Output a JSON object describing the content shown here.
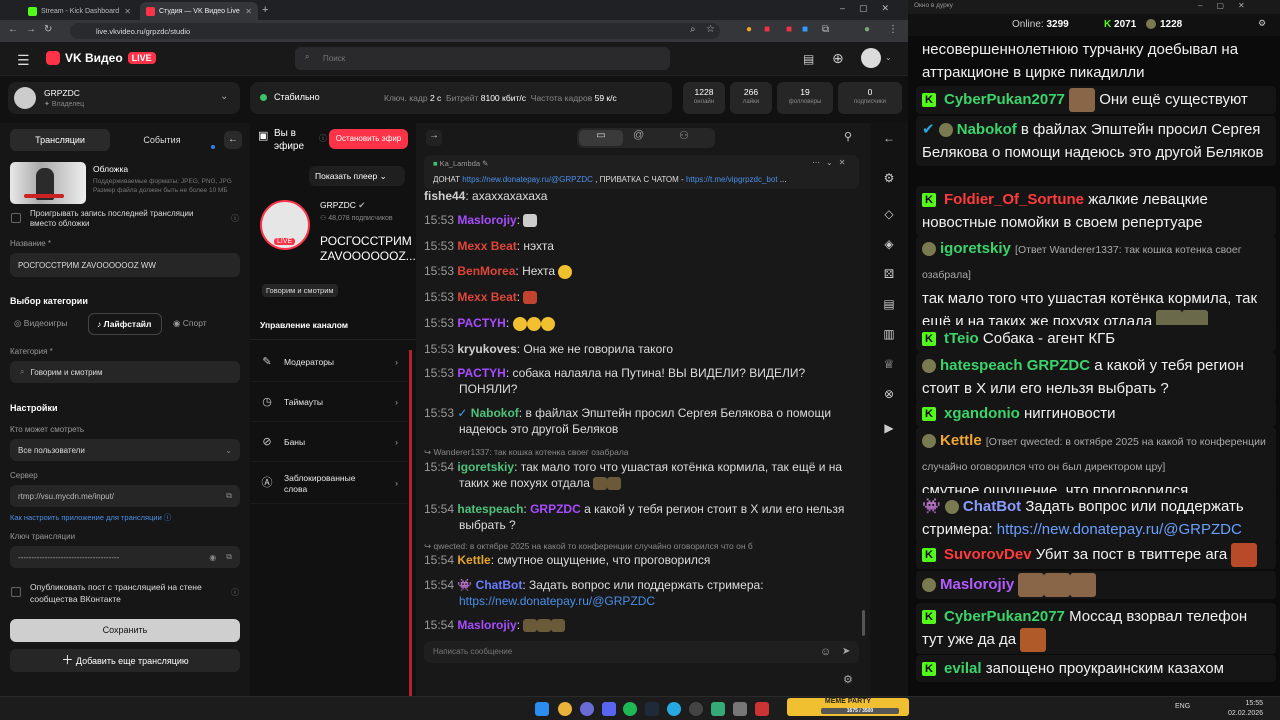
{
  "browser": {
    "tabs": [
      {
        "label": "Stream - Kick Dashboard"
      },
      {
        "label": "Студия — VK Видео Live"
      }
    ],
    "url": "live.vkvideo.ru/grpzdc/studio",
    "new_tab": "+"
  },
  "header": {
    "logo": "VK Видео",
    "live_badge": "LIVE",
    "search_placeholder": "Поиск"
  },
  "channel": {
    "name": "GRPZDC",
    "role": "Владелец"
  },
  "status": {
    "label": "Стабильно",
    "keyframe_label": "Ключ. кадр",
    "keyframe_value": "2 с",
    "bitrate_label": "Битрейт",
    "bitrate_value": "8100 кбит/с",
    "fps_label": "Частота кадров",
    "fps_value": "59 к/с"
  },
  "stats": [
    {
      "value": "1228",
      "label": "онлайн"
    },
    {
      "value": "266",
      "label": "лайки"
    },
    {
      "value": "19",
      "label": "фолловеры"
    },
    {
      "value": "0",
      "label": "подписчики"
    }
  ],
  "left": {
    "tabs": [
      "Трансляции",
      "События"
    ],
    "cover_title": "Обложка",
    "cover_hint": "Поддерживаемые форматы: JPEG, PNG, JPG Размер файла должен быть не более 10 МБ",
    "replay_label": "Проигрывать запись последней трансляции вместо обложки",
    "name_label": "Название *",
    "name_value": "РОСГОССТРИМ ZAVOOOOOOZ WW",
    "category_choice_title": "Выбор категории",
    "cat_games": "Видеоигры",
    "cat_lifestyle": "Лайфстайл",
    "cat_sport": "Спорт",
    "category_label": "Категория *",
    "category_value": "Говорим и смотрим",
    "settings_title": "Настройки",
    "who_label": "Кто может смотреть",
    "who_value": "Все пользователи",
    "server_label": "Сервер",
    "server_value": "rtmp://vsu.mycdn.me/input/",
    "howto_link": "Как настроить приложение для трансляции",
    "key_label": "Ключ трансляции",
    "key_value": "--------------------------------------",
    "publish_label": "Опубликовать пост с трансляцией на стене сообщества ВКонтакте",
    "save_button": "Сохранить",
    "add_button": "Добавить еще трансляцию"
  },
  "middle": {
    "on_air": "Вы в эфире",
    "stop_button": "Остановить эфир",
    "show_player": "Показать плеер",
    "channel": "GRPZDC",
    "subscribers": "48,078 подписчиков",
    "stream_title": "РОСГОССТРИМ ZAVOOOOOOZ...",
    "live_badge": "LIVE",
    "category_chip": "Говорим и смотрим",
    "manage_title": "Управление каналом",
    "menu": [
      "Модераторы",
      "Таймауты",
      "Баны",
      "Заблокированные слова"
    ]
  },
  "chat": {
    "pinned_user": "Ka_Lambda",
    "pinned_text_prefix": "ДОНАТ",
    "pinned_link": "https://new.donatepay.ru/@GRPZDC",
    "pinned_text_mid": ", ПРИВАТКА С ЧАТОМ -",
    "pinned_link2": "https://t.me/vipgrpzdc_bot",
    "pinned_ellipsis": "...",
    "input_placeholder": "Написать сообщение",
    "messages": [
      {
        "time": "",
        "user": "fishe44",
        "color": "#cfcfcf",
        "text": "ахаххахахаха"
      },
      {
        "time": "15:53",
        "user": "Maslorojiy",
        "color": "#a84cff",
        "text": ""
      },
      {
        "time": "15:53",
        "user": "Mexx Beat",
        "color": "#e0453a",
        "text": "нэхта"
      },
      {
        "time": "15:53",
        "user": "BenMorea",
        "color": "#e0453a",
        "text": "Нехта"
      },
      {
        "time": "15:53",
        "user": "Mexx Beat",
        "color": "#e0453a",
        "text": ""
      },
      {
        "time": "15:53",
        "user": "PACTYH",
        "color": "#a84cff",
        "text": ""
      },
      {
        "time": "15:53",
        "user": "kryukoves",
        "color": "#cfcfcf",
        "text": "Она же не говорила такого"
      },
      {
        "time": "15:53",
        "user": "PACTYH",
        "color": "#a84cff",
        "text": "собака налаяла на Путина! ВЫ ВИДЕЛИ? ВИДЕЛИ? ПОНЯЛИ?"
      },
      {
        "time": "15:53",
        "user": "Nabokof",
        "color": "#4ec27a",
        "text": "в файлах Эпштейн просил Сергея Белякова о помощи надеюсь это другой Беляков"
      },
      {
        "time": "15:54",
        "user": "igoretskiy",
        "color": "#4ec27a",
        "text": "так мало того что ушастая котёнка кормила, так ещё и на таких же похуях отдала",
        "reply": "Wanderer1337: так кошка котенка своег озабрала"
      },
      {
        "time": "15:54",
        "user": "hatespeach",
        "color": "#4ec27a",
        "text": "а какой у тебя регион стоит в Х или его нельзя выбрать ?",
        "mention": "GRPZDC"
      },
      {
        "time": "15:54",
        "user": "Kettle",
        "color": "#e7a62c",
        "text": "смутное ощущение, что проговорился",
        "reply": "qwected: в октябре 2025 на какой то конференции случайно оговорился что он б"
      },
      {
        "time": "15:54",
        "user": "ChatBot",
        "color": "#6c7cff",
        "text": "Задать вопрос или поддержать стримера:",
        "link": "https://new.donatepay.ru/@GRPZDC"
      },
      {
        "time": "15:54",
        "user": "Maslorojiy",
        "color": "#a84cff",
        "text": ""
      }
    ]
  },
  "kick": {
    "window_title": "Окно в дурку",
    "online_label": "Online:",
    "online_value": "3299",
    "kick_count": "2071",
    "vk_count": "1228",
    "messages": [
      {
        "user": "",
        "text": "несовершеннолетнюю турчанку доебывал на аттракционе в цирке пикадилли"
      },
      {
        "user": "CyberPukan2077",
        "color": "#3bd46a",
        "text": "Они ещё существуют"
      },
      {
        "user": "Nabokof",
        "color": "#3bd46a",
        "text": "в файлах Эпштейн просил Сергея Белякова о помощи надеюсь это другой Беляков"
      },
      {
        "user": "Foldier_Of_Sortune",
        "color": "#ff3b3b",
        "text": "жалкие левацкие новостные помойки в своем репертуаре"
      },
      {
        "user": "igoretskiy",
        "color": "#3bd46a",
        "reply": "[Ответ Wanderer1337: так кошка котенка своег озабрала]",
        "text": "так мало того что ушастая котёнка кормила, так ещё и на таких же похуях отдала"
      },
      {
        "user": "tTeio",
        "color": "#3bd46a",
        "text": "Собака - агент КГБ"
      },
      {
        "user": "hatespeach",
        "color": "#3bd46a",
        "mention": "GRPZDC",
        "text": "а какой у тебя регион стоит в Х или его нельзя выбрать ?"
      },
      {
        "user": "xgandonio",
        "color": "#3bd46a",
        "text": "ниггиновости"
      },
      {
        "user": "Kettle",
        "color": "#f0a830",
        "reply": "[Ответ qwected: в октябре 2025 на какой то конференции случайно оговорился что он был директором цру]",
        "text": "смутное ощущение, что проговорился"
      },
      {
        "user": "ChatBot",
        "color": "#8a9bff",
        "text": "Задать вопрос или поддержать стримера:",
        "link": "https://new.donatepay.ru/@GRPZDC"
      },
      {
        "user": "SuvorovDev",
        "color": "#ff3b3b",
        "text": "Убит за пост в твиттере ага"
      },
      {
        "user": "Maslorojiy",
        "color": "#b45cff",
        "text": ""
      },
      {
        "user": "CyberPukan2077",
        "color": "#3bd46a",
        "text": "Моссад взорвал телефон тут уже да да"
      },
      {
        "user": "evilal",
        "color": "#3bd46a",
        "text": "запощено проукраинским казахом"
      }
    ]
  },
  "taskbar": {
    "lang": "ENG",
    "time": "15:55",
    "date": "02.02.2026",
    "widget_title": "MEME PARTY",
    "widget_value": "1675 / 3500"
  }
}
